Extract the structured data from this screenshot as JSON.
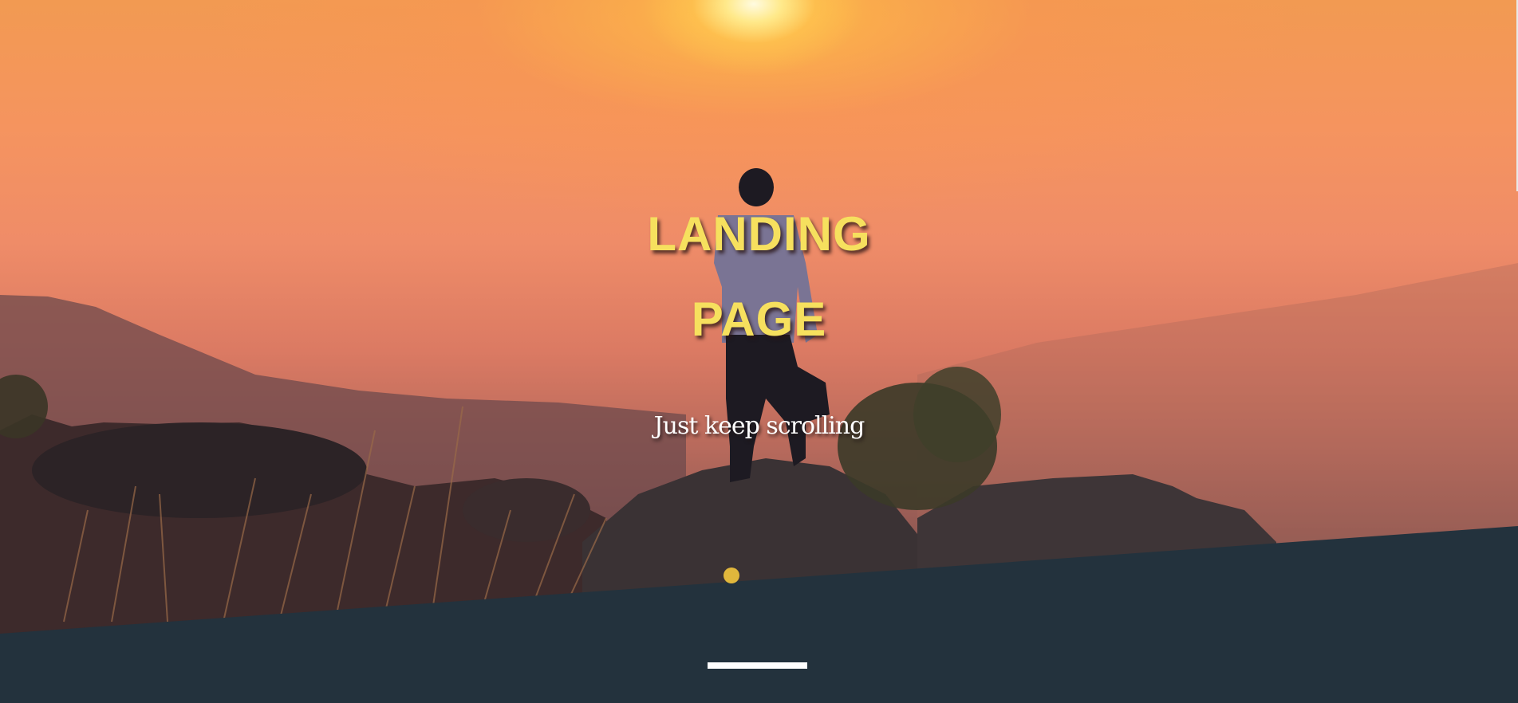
{
  "hero": {
    "title_line1": "LANDING",
    "title_line2": "PAGE",
    "tagline": "Just keep scrolling"
  },
  "colors": {
    "title": "#f6e05e",
    "section_bg": "#23323d",
    "tagline": "#ffffff",
    "divider": "#ffffff"
  }
}
